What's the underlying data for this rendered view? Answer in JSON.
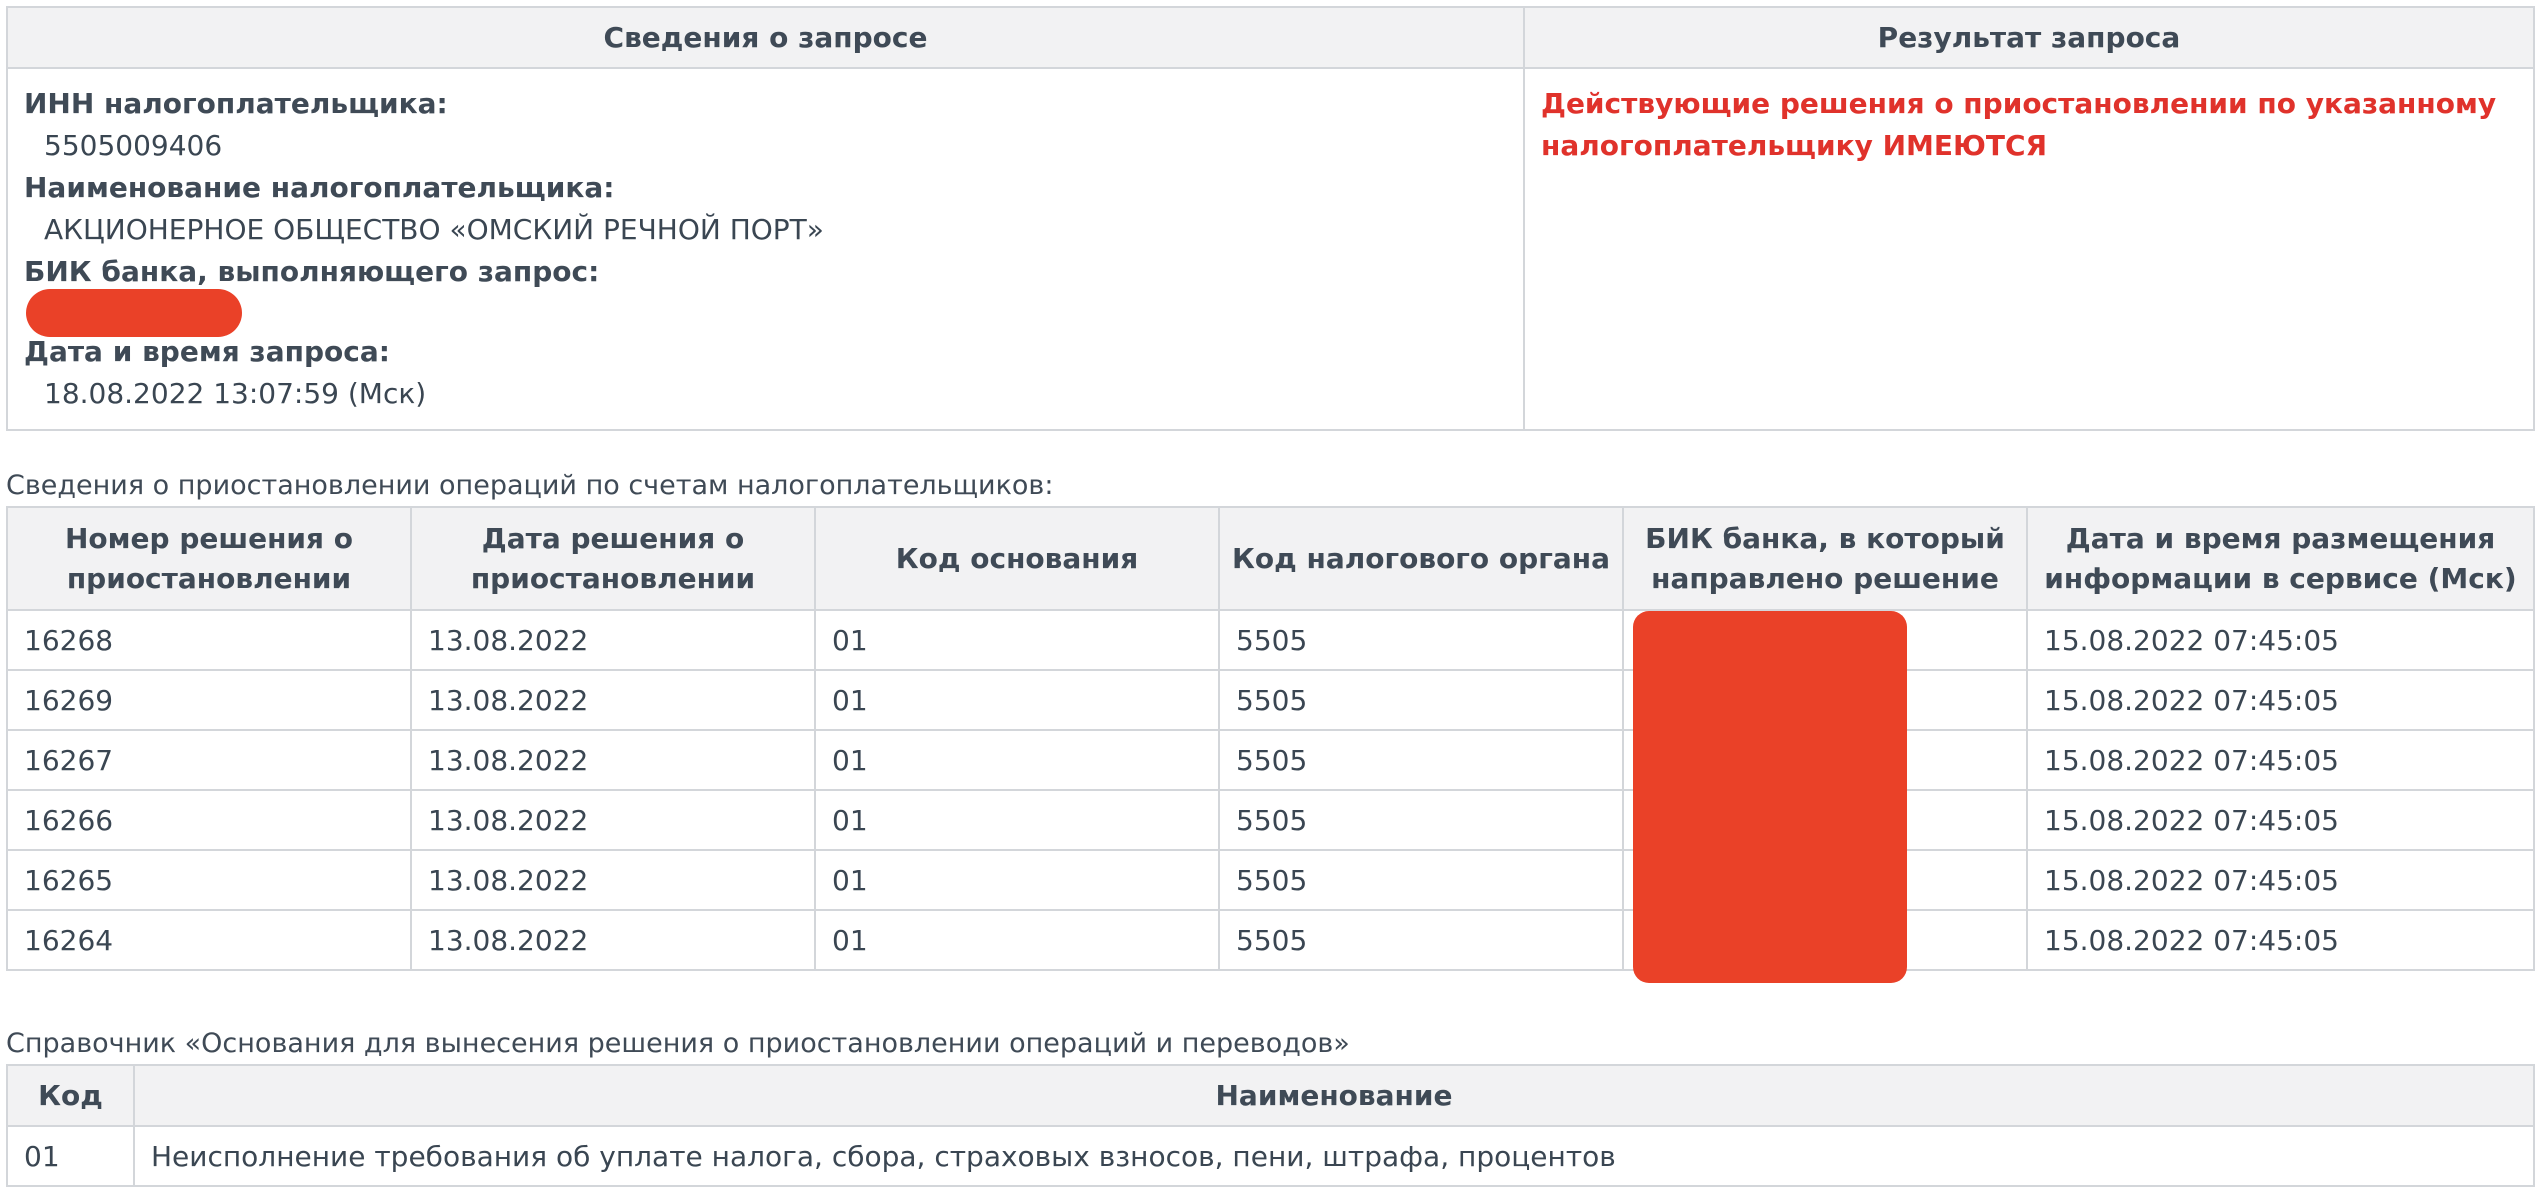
{
  "request_info": {
    "header_left": "Сведения о запросе",
    "header_right": "Результат запроса",
    "inn_label": "ИНН налогоплательщика:",
    "inn_value": "5505009406",
    "name_label": "Наименование налогоплательщика:",
    "name_value": "АКЦИОНЕРНОЕ ОБЩЕСТВО «ОМСКИЙ РЕЧНОЙ ПОРТ»",
    "bik_label": "БИК банка, выполняющего запрос:",
    "datetime_label": "Дата и время запроса:",
    "datetime_value": "18.08.2022 13:07:59 (Мск)",
    "result_line1": "Действующие решения о приостановлении по указанному",
    "result_line2": "налогоплательщику ИМЕЮТСЯ",
    "result_color": "#e0322b",
    "redaction_color": "#ea4128"
  },
  "suspensions": {
    "caption": "Сведения о приостановлении операций по счетам налогоплательщиков:",
    "headers": [
      {
        "line1": "Номер решения о",
        "line2": "приостановлении"
      },
      {
        "line1": "Дата решения о",
        "line2": "приостановлении"
      },
      {
        "line1": "Код основания",
        "line2": ""
      },
      {
        "line1": "Код налогового органа",
        "line2": ""
      },
      {
        "line1": "БИК банка, в который",
        "line2": "направлено решение"
      },
      {
        "line1": "Дата и время размещения",
        "line2": "информации в сервисе (Мск)"
      }
    ],
    "rows": [
      {
        "number": "16268",
        "date": "13.08.2022",
        "code": "01",
        "tax_office": "5505",
        "bik": "",
        "posted": "15.08.2022 07:45:05"
      },
      {
        "number": "16269",
        "date": "13.08.2022",
        "code": "01",
        "tax_office": "5505",
        "bik": "",
        "posted": "15.08.2022 07:45:05"
      },
      {
        "number": "16267",
        "date": "13.08.2022",
        "code": "01",
        "tax_office": "5505",
        "bik": "",
        "posted": "15.08.2022 07:45:05"
      },
      {
        "number": "16266",
        "date": "13.08.2022",
        "code": "01",
        "tax_office": "5505",
        "bik": "",
        "posted": "15.08.2022 07:45:05"
      },
      {
        "number": "16265",
        "date": "13.08.2022",
        "code": "01",
        "tax_office": "5505",
        "bik": "",
        "posted": "15.08.2022 07:45:05"
      },
      {
        "number": "16264",
        "date": "13.08.2022",
        "code": "01",
        "tax_office": "5505",
        "bik": "",
        "posted": "15.08.2022 07:45:05"
      }
    ]
  },
  "reference": {
    "caption": "Справочник «Основания для вынесения решения о приостановлении операций и переводов»",
    "headers": [
      "Код",
      "Наименование"
    ],
    "rows": [
      {
        "code": "01",
        "name": "Неисполнение требования об уплате налога, сбора, страховых взносов, пени, штрафа, процентов"
      }
    ]
  }
}
